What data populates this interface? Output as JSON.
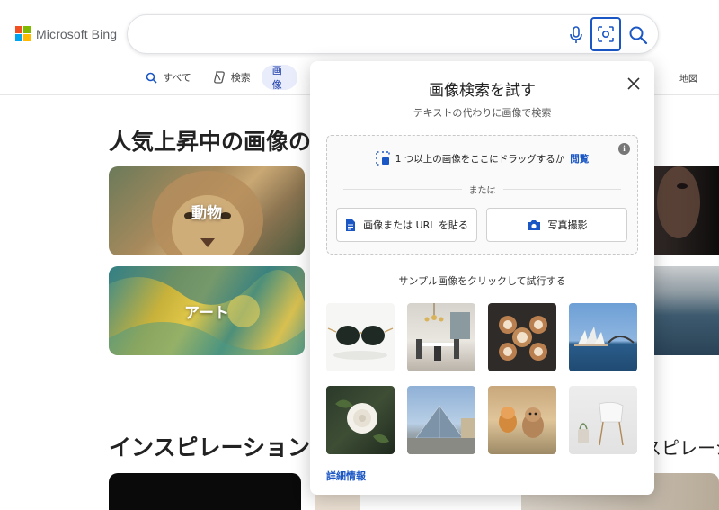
{
  "app": {
    "logo_text": "Microsoft Bing"
  },
  "search": {
    "value": "",
    "placeholder": ""
  },
  "tabs": [
    {
      "label": "すべて",
      "icon": "search-icon"
    },
    {
      "label": "検索",
      "icon": "copilot-icon"
    },
    {
      "label": "画像",
      "icon": "image-icon",
      "active": true
    },
    {
      "label": "地図"
    }
  ],
  "sections": {
    "popular_title": "人気上昇中の画像の",
    "inspiration_title": "インスピレーション",
    "inspiration_right_title": "スピレーシ"
  },
  "cards": [
    {
      "label": "動物"
    },
    {
      "label": "アート"
    }
  ],
  "modal": {
    "title": "画像検索を試す",
    "subtitle": "テキストの代わりに画像で検索",
    "drag_text": "1 つ以上の画像をここにドラッグするか",
    "browse_label": "閲覧",
    "or_text": "または",
    "paste_button": "画像または URL を貼る",
    "camera_button": "写真撮影",
    "sample_label": "サンプル画像をクリックして試行する",
    "more_info": "詳細情報",
    "samples": [
      {
        "name": "sunglasses"
      },
      {
        "name": "dining-room"
      },
      {
        "name": "latte-art"
      },
      {
        "name": "sydney-opera-house"
      },
      {
        "name": "white-rose"
      },
      {
        "name": "louvre-pyramid"
      },
      {
        "name": "running-dogs"
      },
      {
        "name": "white-chair"
      }
    ]
  },
  "colors": {
    "accent": "#1a56c4",
    "logo_red": "#f25022",
    "logo_green": "#7fba00",
    "logo_blue": "#00a4ef",
    "logo_yellow": "#ffb900"
  }
}
